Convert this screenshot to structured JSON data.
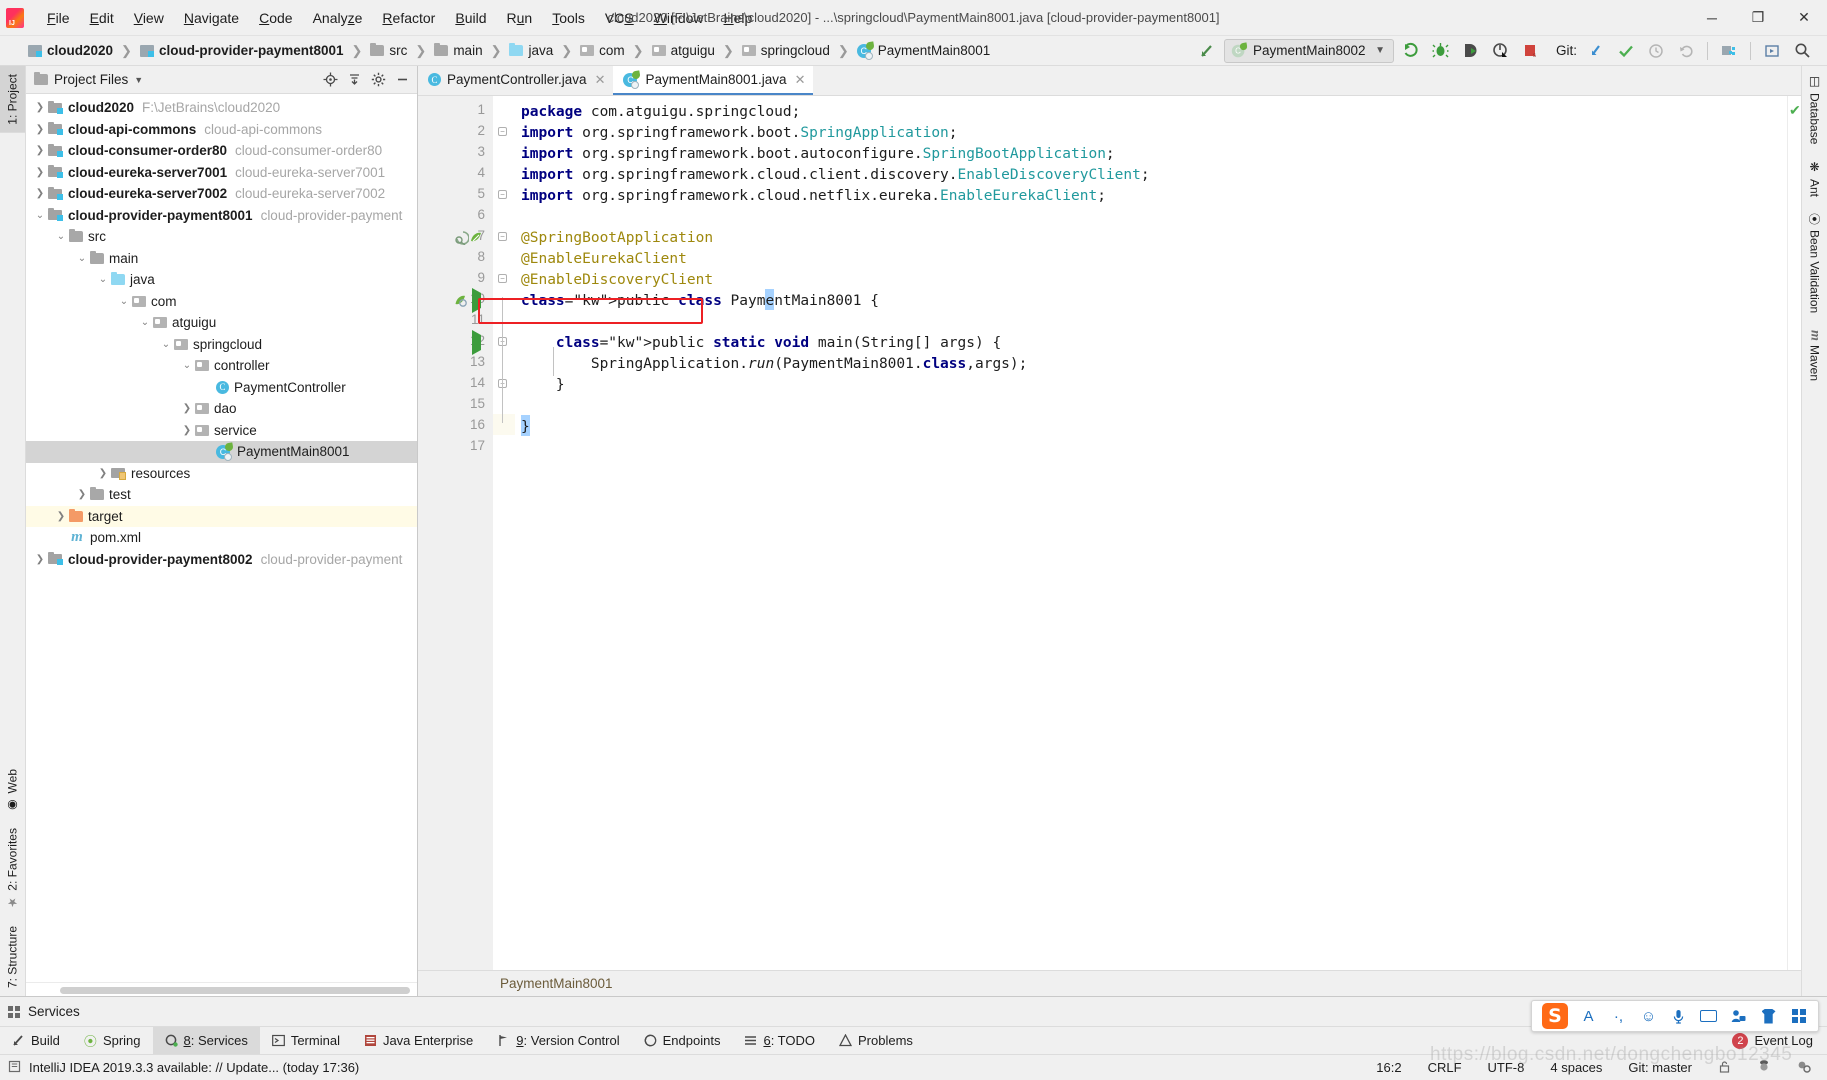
{
  "window": {
    "title": "cloud2020 [F:\\JetBrains\\cloud2020] - ...\\springcloud\\PaymentMain8001.java [cloud-provider-payment8001]",
    "minimize": "─",
    "maximize": "❐",
    "close": "✕"
  },
  "menubar": [
    {
      "label": "File"
    },
    {
      "label": "Edit"
    },
    {
      "label": "View"
    },
    {
      "label": "Navigate"
    },
    {
      "label": "Code"
    },
    {
      "label": "Analyze"
    },
    {
      "label": "Refactor"
    },
    {
      "label": "Build"
    },
    {
      "label": "Run"
    },
    {
      "label": "Tools"
    },
    {
      "label": "VCS"
    },
    {
      "label": "Window"
    },
    {
      "label": "Help"
    }
  ],
  "breadcrumbs": [
    {
      "label": "cloud2020",
      "icon": "module-icon"
    },
    {
      "label": "cloud-provider-payment8001",
      "icon": "module-icon"
    },
    {
      "label": "src",
      "icon": "folder-icon"
    },
    {
      "label": "main",
      "icon": "folder-icon"
    },
    {
      "label": "java",
      "icon": "source-folder-icon"
    },
    {
      "label": "com",
      "icon": "package-icon"
    },
    {
      "label": "atguigu",
      "icon": "package-icon"
    },
    {
      "label": "springcloud",
      "icon": "package-icon"
    },
    {
      "label": "PaymentMain8001",
      "icon": "spring-class-icon"
    }
  ],
  "toolbar": {
    "run_config": "PaymentMain8002",
    "git_label": "Git:",
    "buttons": [
      {
        "name": "run-button"
      },
      {
        "name": "debug-button"
      },
      {
        "name": "run-with-coverage-button"
      },
      {
        "name": "profile-button"
      },
      {
        "name": "stop-button"
      }
    ]
  },
  "left_strip": [
    {
      "label": "1: Project",
      "active": true
    },
    {
      "label": "Web",
      "active": false
    },
    {
      "label": "2: Favorites",
      "active": false
    },
    {
      "label": "7: Structure",
      "active": false
    }
  ],
  "right_strip": [
    {
      "label": "Database"
    },
    {
      "label": "Ant"
    },
    {
      "label": "Bean Validation"
    },
    {
      "label": "Maven"
    }
  ],
  "project_panel": {
    "title": "Project Files",
    "actions": [
      "locate-icon",
      "collapse-all-icon",
      "settings-icon",
      "hide-icon"
    ],
    "tree": [
      {
        "indent": 0,
        "arrow": "collapsed",
        "icon": "module-icon",
        "label": "cloud2020",
        "bold": true,
        "sub": "F:\\JetBrains\\cloud2020"
      },
      {
        "indent": 0,
        "arrow": "collapsed",
        "icon": "module-icon",
        "label": "cloud-api-commons",
        "bold": true,
        "sub": "cloud-api-commons"
      },
      {
        "indent": 0,
        "arrow": "collapsed",
        "icon": "module-icon",
        "label": "cloud-consumer-order80",
        "bold": true,
        "sub": "cloud-consumer-order80"
      },
      {
        "indent": 0,
        "arrow": "collapsed",
        "icon": "module-icon",
        "label": "cloud-eureka-server7001",
        "bold": true,
        "sub": "cloud-eureka-server7001"
      },
      {
        "indent": 0,
        "arrow": "collapsed",
        "icon": "module-icon",
        "label": "cloud-eureka-server7002",
        "bold": true,
        "sub": "cloud-eureka-server7002"
      },
      {
        "indent": 0,
        "arrow": "expanded",
        "icon": "module-icon",
        "label": "cloud-provider-payment8001",
        "bold": true,
        "sub": "cloud-provider-payment"
      },
      {
        "indent": 1,
        "arrow": "expanded",
        "icon": "folder-icon",
        "label": "src",
        "bold": false,
        "sub": ""
      },
      {
        "indent": 2,
        "arrow": "expanded",
        "icon": "folder-icon",
        "label": "main",
        "bold": false,
        "sub": ""
      },
      {
        "indent": 3,
        "arrow": "expanded",
        "icon": "source-folder-icon",
        "label": "java",
        "bold": false,
        "sub": ""
      },
      {
        "indent": 4,
        "arrow": "expanded",
        "icon": "package-icon",
        "label": "com",
        "bold": false,
        "sub": ""
      },
      {
        "indent": 5,
        "arrow": "expanded",
        "icon": "package-icon",
        "label": "atguigu",
        "bold": false,
        "sub": ""
      },
      {
        "indent": 6,
        "arrow": "expanded",
        "icon": "package-icon",
        "label": "springcloud",
        "bold": false,
        "sub": ""
      },
      {
        "indent": 7,
        "arrow": "expanded",
        "icon": "package-icon",
        "label": "controller",
        "bold": false,
        "sub": ""
      },
      {
        "indent": 8,
        "arrow": "none",
        "icon": "class-icon",
        "label": "PaymentController",
        "bold": false,
        "sub": ""
      },
      {
        "indent": 7,
        "arrow": "collapsed",
        "icon": "package-icon",
        "label": "dao",
        "bold": false,
        "sub": ""
      },
      {
        "indent": 7,
        "arrow": "collapsed",
        "icon": "package-icon",
        "label": "service",
        "bold": false,
        "sub": ""
      },
      {
        "indent": 8,
        "arrow": "none",
        "icon": "spring-class-icon",
        "label": "PaymentMain8001",
        "bold": false,
        "sub": "",
        "selected": true
      },
      {
        "indent": 3,
        "arrow": "collapsed",
        "icon": "resources-icon",
        "label": "resources",
        "bold": false,
        "sub": ""
      },
      {
        "indent": 2,
        "arrow": "collapsed",
        "icon": "folder-icon",
        "label": "test",
        "bold": false,
        "sub": ""
      },
      {
        "indent": 1,
        "arrow": "collapsed",
        "icon": "target-folder-icon",
        "label": "target",
        "bold": false,
        "sub": "",
        "highlight": true
      },
      {
        "indent": 1,
        "arrow": "none",
        "icon": "maven-icon",
        "label": "pom.xml",
        "bold": false,
        "sub": ""
      },
      {
        "indent": 0,
        "arrow": "collapsed",
        "icon": "module-icon",
        "label": "cloud-provider-payment8002",
        "bold": true,
        "sub": "cloud-provider-payment"
      }
    ]
  },
  "editor": {
    "tabs": [
      {
        "label": "PaymentController.java",
        "icon": "class-icon",
        "active": false
      },
      {
        "label": "PaymentMain8001.java",
        "icon": "spring-class-icon",
        "active": true
      }
    ],
    "breadcrumb_bottom": "PaymentMain8001",
    "caret_line": 16,
    "lines": [
      {
        "n": 1,
        "text": "package com.atguigu.springcloud;"
      },
      {
        "n": 2,
        "text": "import org.springframework.boot.SpringApplication;"
      },
      {
        "n": 3,
        "text": "import org.springframework.boot.autoconfigure.SpringBootApplication;"
      },
      {
        "n": 4,
        "text": "import org.springframework.cloud.client.discovery.EnableDiscoveryClient;"
      },
      {
        "n": 5,
        "text": "import org.springframework.cloud.netflix.eureka.EnableEurekaClient;"
      },
      {
        "n": 6,
        "text": ""
      },
      {
        "n": 7,
        "text": "@SpringBootApplication"
      },
      {
        "n": 8,
        "text": "@EnableEurekaClient"
      },
      {
        "n": 9,
        "text": "@EnableDiscoveryClient"
      },
      {
        "n": 10,
        "text": "public class PaymentMain8001 {"
      },
      {
        "n": 11,
        "text": ""
      },
      {
        "n": 12,
        "text": "    public static void main(String[] args) {"
      },
      {
        "n": 13,
        "text": "        SpringApplication.run(PaymentMain8001.class,args);"
      },
      {
        "n": 14,
        "text": "    }"
      },
      {
        "n": 15,
        "text": ""
      },
      {
        "n": 16,
        "text": "}"
      },
      {
        "n": 17,
        "text": ""
      }
    ],
    "annotation": {
      "name": "red-highlight-box",
      "target_line": 9,
      "color": "#ed2024"
    }
  },
  "services": {
    "title": "Services"
  },
  "tool_windows": [
    {
      "label": "Build",
      "icon": "build-icon",
      "active": false
    },
    {
      "label": "Spring",
      "icon": "spring-icon",
      "active": false
    },
    {
      "label": "8: Services",
      "icon": "services-icon",
      "active": true
    },
    {
      "label": "Terminal",
      "icon": "terminal-icon",
      "active": false
    },
    {
      "label": "Java Enterprise",
      "icon": "java-enterprise-icon",
      "active": false
    },
    {
      "label": "9: Version Control",
      "icon": "version-control-icon",
      "active": false
    },
    {
      "label": "Endpoints",
      "icon": "endpoints-icon",
      "active": false
    },
    {
      "label": "6: TODO",
      "icon": "todo-icon",
      "active": false
    },
    {
      "label": "Problems",
      "icon": "problems-icon",
      "active": false
    }
  ],
  "event_log": {
    "label": "Event Log",
    "badge": "2"
  },
  "statusbar": {
    "message": "IntelliJ IDEA 2019.3.3 available: // Update... (today 17:36)",
    "caret_position": "16:2",
    "line_separator": "CRLF",
    "encoding": "UTF-8",
    "indent": "4 spaces",
    "branch": "Git: master"
  },
  "ime": {
    "logo": "S",
    "items": [
      "A",
      "·,",
      "☺",
      "mic-icon",
      "keyboard-icon",
      "user-icon",
      "skin-icon",
      "toolbox-icon"
    ]
  },
  "watermark": "https://blog.csdn.net/dongchengbo12345",
  "colors": {
    "accent": "#4a86c8",
    "annotation_red": "#ed2024",
    "keyword": "#000080",
    "java_annotation": "#9e880d",
    "class_ref": "#20999d",
    "selection": "#a6d2ff",
    "caret_row": "#fcfaef"
  }
}
